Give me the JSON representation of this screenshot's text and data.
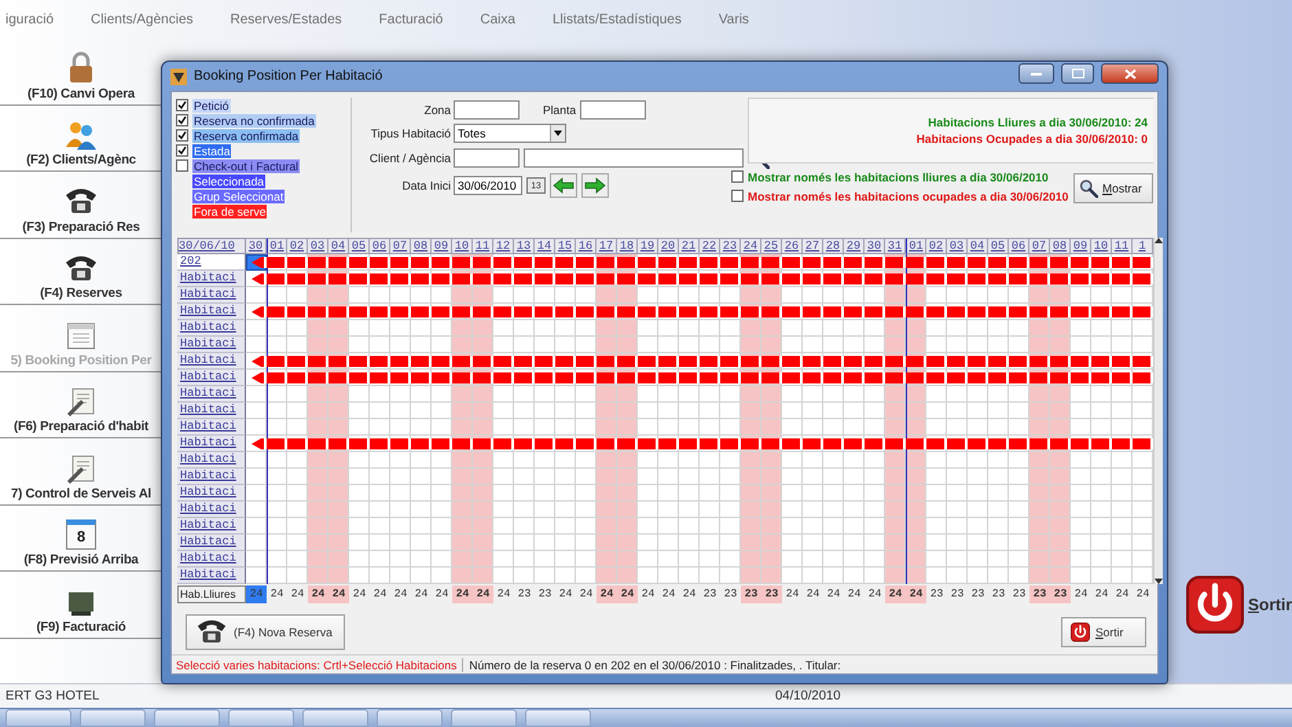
{
  "menu": [
    "iguració",
    "Clients/Agències",
    "Reserves/Estades",
    "Facturació",
    "Caixa",
    "Llistats/Estadístiques",
    "Varis"
  ],
  "sidebar": {
    "items": [
      {
        "label": "(F10) Canvi Opera",
        "disabled": false
      },
      {
        "label": "(F2) Clients/Agènc",
        "disabled": false
      },
      {
        "label": "(F3) Preparació Res",
        "disabled": false
      },
      {
        "label": "(F4) Reserves",
        "disabled": false
      },
      {
        "label": "5) Booking Position Per",
        "disabled": true
      },
      {
        "label": "(F6) Preparació d'habit",
        "disabled": false
      },
      {
        "label": "7) Control de Serveis Al",
        "disabled": false
      },
      {
        "label": "(F8) Previsió Arriba",
        "disabled": false,
        "icon_text": "8"
      },
      {
        "label": "(F9) Facturació",
        "disabled": false
      }
    ]
  },
  "dialog": {
    "title": "Booking Position Per Habitació",
    "legend": [
      {
        "label": "Petició",
        "kind": "checkbox",
        "checked": true,
        "color": "#c4d6f8"
      },
      {
        "label": "Reserva no confirmada",
        "kind": "checkbox",
        "checked": true,
        "color": "#b2cdf4"
      },
      {
        "label": "Reserva confirmada",
        "kind": "checkbox",
        "checked": true,
        "color": "#8cbef0"
      },
      {
        "label": "Estada",
        "kind": "checkbox",
        "checked": true,
        "color": "#2f6cf0"
      },
      {
        "label": "Check-out i Factural",
        "kind": "checkbox",
        "checked": false,
        "color": "#8c8cf4"
      },
      {
        "label": "Seleccionada",
        "kind": "swatch",
        "color": "#4848ff"
      },
      {
        "label": "Grup Seleccionat",
        "kind": "swatch",
        "color": "#6a6aff"
      },
      {
        "label": "Fora de serve",
        "kind": "swatch",
        "color": "#ff2020"
      }
    ],
    "filters": {
      "zona_label": "Zona",
      "planta_label": "Planta",
      "tipus_label": "Tipus Habitació",
      "tipus_value": "Totes",
      "client_label": "Client / Agència",
      "date_label": "Data Inici",
      "date_value": "30/06/2010",
      "picker_text": "13"
    },
    "summary": {
      "free": "Habitacions Lliures a dia 30/06/2010: 24",
      "occupied": "Habitacions Ocupades a dia 30/06/2010: 0"
    },
    "options": [
      {
        "label": "Mostrar només les habitacions lliures a dia 30/06/2010",
        "checked": false,
        "color": "#1a8a1a"
      },
      {
        "label": "Mostrar només les habitacions ocupades a dia 30/06/2010",
        "checked": false,
        "color": "#e01818"
      }
    ],
    "show_button": "Mostrar",
    "grid": {
      "corner": "30/06/10",
      "free_label": "Hab.Lliures",
      "days": [
        {
          "label": "30",
          "weekend": false,
          "month_start": false,
          "selected": true,
          "free": "24"
        },
        {
          "label": "01",
          "weekend": false,
          "month_start": true,
          "selected": false,
          "free": "24"
        },
        {
          "label": "02",
          "weekend": false,
          "month_start": false,
          "selected": false,
          "free": "24"
        },
        {
          "label": "03",
          "weekend": true,
          "month_start": false,
          "selected": false,
          "free": "24"
        },
        {
          "label": "04",
          "weekend": true,
          "month_start": false,
          "selected": false,
          "free": "24"
        },
        {
          "label": "05",
          "weekend": false,
          "month_start": false,
          "selected": false,
          "free": "24"
        },
        {
          "label": "06",
          "weekend": false,
          "month_start": false,
          "selected": false,
          "free": "24"
        },
        {
          "label": "07",
          "weekend": false,
          "month_start": false,
          "selected": false,
          "free": "24"
        },
        {
          "label": "08",
          "weekend": false,
          "month_start": false,
          "selected": false,
          "free": "24"
        },
        {
          "label": "09",
          "weekend": false,
          "month_start": false,
          "selected": false,
          "free": "24"
        },
        {
          "label": "10",
          "weekend": true,
          "month_start": false,
          "selected": false,
          "free": "24"
        },
        {
          "label": "11",
          "weekend": true,
          "month_start": false,
          "selected": false,
          "free": "24"
        },
        {
          "label": "12",
          "weekend": false,
          "month_start": false,
          "selected": false,
          "free": "24"
        },
        {
          "label": "13",
          "weekend": false,
          "month_start": false,
          "selected": false,
          "free": "23"
        },
        {
          "label": "14",
          "weekend": false,
          "month_start": false,
          "selected": false,
          "free": "23"
        },
        {
          "label": "15",
          "weekend": false,
          "month_start": false,
          "selected": false,
          "free": "24"
        },
        {
          "label": "16",
          "weekend": false,
          "month_start": false,
          "selected": false,
          "free": "24"
        },
        {
          "label": "17",
          "weekend": true,
          "month_start": false,
          "selected": false,
          "free": "24"
        },
        {
          "label": "18",
          "weekend": true,
          "month_start": false,
          "selected": false,
          "free": "24"
        },
        {
          "label": "19",
          "weekend": false,
          "month_start": false,
          "selected": false,
          "free": "24"
        },
        {
          "label": "20",
          "weekend": false,
          "month_start": false,
          "selected": false,
          "free": "24"
        },
        {
          "label": "21",
          "weekend": false,
          "month_start": false,
          "selected": false,
          "free": "24"
        },
        {
          "label": "22",
          "weekend": false,
          "month_start": false,
          "selected": false,
          "free": "23"
        },
        {
          "label": "23",
          "weekend": false,
          "month_start": false,
          "selected": false,
          "free": "23"
        },
        {
          "label": "24",
          "weekend": true,
          "month_start": false,
          "selected": false,
          "free": "23"
        },
        {
          "label": "25",
          "weekend": true,
          "month_start": false,
          "selected": false,
          "free": "23"
        },
        {
          "label": "26",
          "weekend": false,
          "month_start": false,
          "selected": false,
          "free": "24"
        },
        {
          "label": "27",
          "weekend": false,
          "month_start": false,
          "selected": false,
          "free": "24"
        },
        {
          "label": "28",
          "weekend": false,
          "month_start": false,
          "selected": false,
          "free": "24"
        },
        {
          "label": "29",
          "weekend": false,
          "month_start": false,
          "selected": false,
          "free": "24"
        },
        {
          "label": "30",
          "weekend": false,
          "month_start": false,
          "selected": false,
          "free": "24"
        },
        {
          "label": "31",
          "weekend": true,
          "month_start": false,
          "selected": false,
          "free": "24"
        },
        {
          "label": "01",
          "weekend": true,
          "month_start": true,
          "selected": false,
          "free": "24"
        },
        {
          "label": "02",
          "weekend": false,
          "month_start": false,
          "selected": false,
          "free": "23"
        },
        {
          "label": "03",
          "weekend": false,
          "month_start": false,
          "selected": false,
          "free": "23"
        },
        {
          "label": "04",
          "weekend": false,
          "month_start": false,
          "selected": false,
          "free": "23"
        },
        {
          "label": "05",
          "weekend": false,
          "month_start": false,
          "selected": false,
          "free": "23"
        },
        {
          "label": "06",
          "weekend": false,
          "month_start": false,
          "selected": false,
          "free": "23"
        },
        {
          "label": "07",
          "weekend": true,
          "month_start": false,
          "selected": false,
          "free": "23"
        },
        {
          "label": "08",
          "weekend": true,
          "month_start": false,
          "selected": false,
          "free": "23"
        },
        {
          "label": "09",
          "weekend": false,
          "month_start": false,
          "selected": false,
          "free": "24"
        },
        {
          "label": "10",
          "weekend": false,
          "month_start": false,
          "selected": false,
          "free": "24"
        },
        {
          "label": "11",
          "weekend": false,
          "month_start": false,
          "selected": false,
          "free": "24"
        },
        {
          "label": "1",
          "weekend": false,
          "month_start": false,
          "selected": false,
          "free": "24"
        }
      ],
      "rows": [
        {
          "label": "202",
          "booked": true,
          "selected": true
        },
        {
          "label": "Habitaci",
          "booked": true,
          "selected": false
        },
        {
          "label": "Habitaci",
          "booked": false,
          "selected": false
        },
        {
          "label": "Habitaci",
          "booked": true,
          "selected": false
        },
        {
          "label": "Habitaci",
          "booked": false,
          "selected": false
        },
        {
          "label": "Habitaci",
          "booked": false,
          "selected": false
        },
        {
          "label": "Habitaci",
          "booked": true,
          "selected": false
        },
        {
          "label": "Habitaci",
          "booked": true,
          "selected": false
        },
        {
          "label": "Habitaci",
          "booked": false,
          "selected": false
        },
        {
          "label": "Habitaci",
          "booked": false,
          "selected": false
        },
        {
          "label": "Habitaci",
          "booked": false,
          "selected": false
        },
        {
          "label": "Habitaci",
          "booked": true,
          "selected": false
        },
        {
          "label": "Habitaci",
          "booked": false,
          "selected": false
        },
        {
          "label": "Habitaci",
          "booked": false,
          "selected": false
        },
        {
          "label": "Habitaci",
          "booked": false,
          "selected": false
        },
        {
          "label": "Habitaci",
          "booked": false,
          "selected": false
        },
        {
          "label": "Habitaci",
          "booked": false,
          "selected": false
        },
        {
          "label": "Habitaci",
          "booked": false,
          "selected": false
        },
        {
          "label": "Habitaci",
          "booked": false,
          "selected": false
        },
        {
          "label": "Habitaci",
          "booked": false,
          "selected": false
        }
      ]
    },
    "new_button": "(F4) Nova Reserva",
    "exit_button": "Sortir",
    "status": {
      "hint": "Selecció varies habitacions: Crtl+Selecció Habitacions",
      "info": "Número de la reserva 0 en 202 en el 30/06/2010 : Finalitzades, . Titular:"
    }
  },
  "exit_button": "Sortir",
  "status_bar": {
    "app": "ERT G3 HOTEL",
    "date": "04/10/2010"
  }
}
